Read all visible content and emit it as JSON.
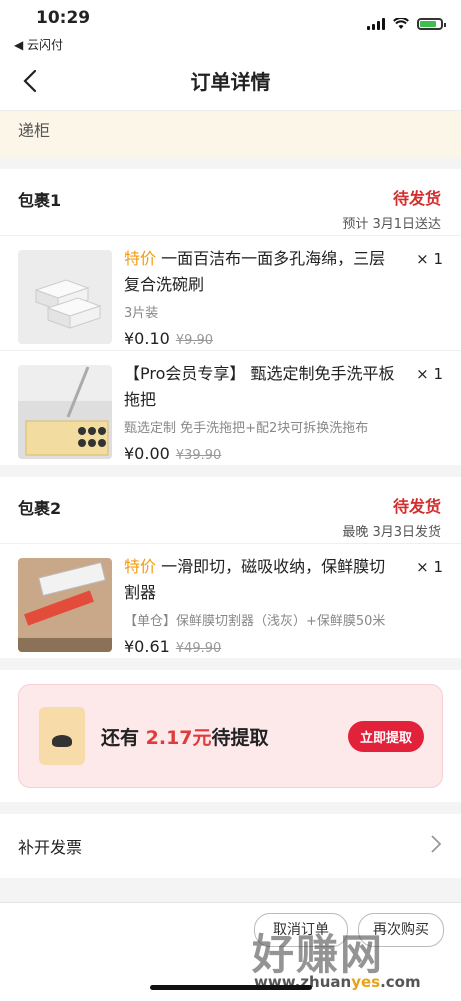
{
  "status_bar": {
    "time": "10:29",
    "back_app": "◀ 云闪付"
  },
  "nav": {
    "title": "订单详情"
  },
  "address": {
    "text": "递柜"
  },
  "packages": [
    {
      "name": "包裹1",
      "status": "待发货",
      "eta": "预计 3月1日送达",
      "items": [
        {
          "tag": "特价",
          "title": " 一面百洁布一面多孔海绵，三层复合洗碗刷",
          "spec": "3片装",
          "price": "¥0.10",
          "orig": "¥9.90",
          "qty": "× 1"
        },
        {
          "tag": "",
          "title": "【Pro会员专享】 甄选定制免手洗平板拖把",
          "spec": "甄选定制 免手洗拖把+配2块可拆换洗拖布",
          "price": "¥0.00",
          "orig": "¥39.90",
          "qty": "× 1"
        }
      ]
    },
    {
      "name": "包裹2",
      "status": "待发货",
      "eta": "最晚 3月3日发货",
      "items": [
        {
          "tag": "特价",
          "title": " 一滑即切，磁吸收纳，保鲜膜切割器",
          "spec": "【单仓】保鲜膜切割器（浅灰）+保鲜膜50米",
          "price": "¥0.61",
          "orig": "¥49.90",
          "qty": "× 1"
        }
      ]
    }
  ],
  "promo": {
    "prefix": "还有 ",
    "amount": "2.17元",
    "suffix": "待提取",
    "button": "立即提取"
  },
  "invoice": {
    "label": "补开发票"
  },
  "bottom_bar": {
    "btn1": "取消订单",
    "btn2": "再次购买"
  },
  "watermark": {
    "big": "好赚网",
    "url_a": "www.zhuan",
    "url_b": "yes",
    "url_c": ".com"
  },
  "colors": {
    "status_red": "#d32e2e",
    "tag_orange": "#f39c12",
    "promo_button": "#e2213a"
  }
}
